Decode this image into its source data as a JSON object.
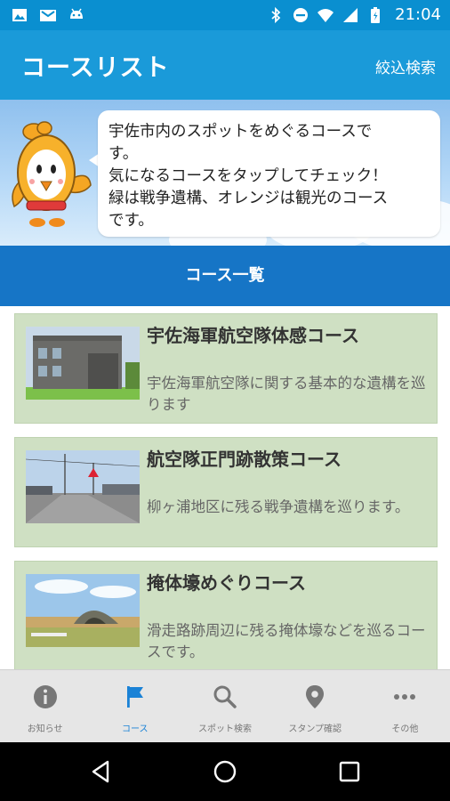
{
  "status_bar": {
    "time": "21:04",
    "left_icons": [
      "image-icon",
      "gmail-icon",
      "android-icon"
    ],
    "right_icons": [
      "bluetooth-icon",
      "do-not-disturb-icon",
      "wifi-icon",
      "signal-icon",
      "battery-icon"
    ]
  },
  "app_bar": {
    "title": "コースリスト",
    "filter_label": "絞込検索"
  },
  "banner": {
    "lines": [
      "宇佐市内のスポットをめぐるコースで",
      "す。",
      "気になるコースをタップしてチェック！",
      "緑は戦争遺構、オレンジは観光のコース",
      "です。"
    ]
  },
  "section_header": "コース一覧",
  "courses": [
    {
      "title": "宇佐海軍航空隊体感コース",
      "desc": "宇佐海軍航空隊に関する基本的な遺構を巡ります"
    },
    {
      "title": "航空隊正門跡散策コース",
      "desc": "柳ヶ浦地区に残る戦争遺構を巡ります。"
    },
    {
      "title": "掩体壕めぐりコース",
      "desc": "滑走路跡周辺に残る掩体壕などを巡るコースです。"
    }
  ],
  "bottom_nav": {
    "items": [
      {
        "label": "お知らせ",
        "icon": "info-icon",
        "active": false
      },
      {
        "label": "コース",
        "icon": "flag-icon",
        "active": true
      },
      {
        "label": "スポット検索",
        "icon": "search-icon",
        "active": false
      },
      {
        "label": "スタンプ確認",
        "icon": "location-pin-icon",
        "active": false
      },
      {
        "label": "その他",
        "icon": "more-icon",
        "active": false
      }
    ]
  },
  "colors": {
    "status_bar": "#0a8fd0",
    "app_bar": "#1a9ad9",
    "section_header": "#1675c6",
    "war_course_card": "#cfe0c3",
    "active_nav": "#1a82d6"
  }
}
